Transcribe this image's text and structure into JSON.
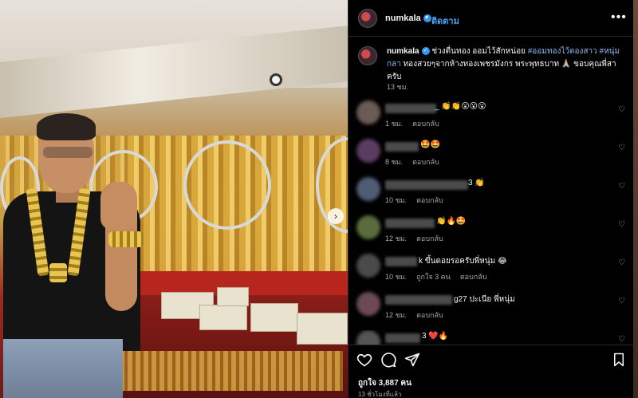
{
  "post": {
    "author": "numkala",
    "follow_label": "ติดตาม",
    "dot": "•",
    "more": "•••"
  },
  "caption": {
    "author": "numkala",
    "text_1": "ช่วงตื่นทอง ออมไว้สักหน่อย",
    "hashtag_1": "#ออมทองไว้ตองสาว",
    "hashtag_2": "#หนุ่มกลา",
    "text_2": "ทองสวยๆจากห้างทองเพชรมังกร พระพุทธบาท 🙏🏼 ขอบคุณพี่สาครับ",
    "time": "13 ชม."
  },
  "comments": [
    {
      "text": "_ 👏👏😮😮😮",
      "time": "1 ชม.",
      "reply": "ตอบกลับ",
      "likes": "",
      "avatar_color": "#6b5a55"
    },
    {
      "text": "🤩🤩",
      "time": "8 ชม.",
      "reply": "ตอบกลับ",
      "likes": "",
      "avatar_color": "#5a3c62"
    },
    {
      "text": "3 👏",
      "time": "10 ชม.",
      "reply": "ตอบกลับ",
      "likes": "",
      "avatar_color": "#4f5d74"
    },
    {
      "text": "👏🔥🤩",
      "time": "12 ชม.",
      "reply": "ตอบกลับ",
      "likes": "",
      "avatar_color": "#5a6b3c"
    },
    {
      "text": "k ขึ้นดอยรอครับพี่หนุ่ม 😂",
      "time": "10 ชม.",
      "reply": "ตอบกลับ",
      "likes": "ถูกใจ 3 คน",
      "avatar_color": "#4a4a4a"
    },
    {
      "text": "g27 ปะเนีย พี่หนุ่ม",
      "time": "12 ชม.",
      "reply": "ตอบกลับ",
      "likes": "",
      "avatar_color": "#6b4a55"
    },
    {
      "text": "3 ❤️🔥",
      "time": "",
      "reply": "",
      "likes": "",
      "avatar_color": "#555555"
    }
  ],
  "actions": {
    "likes": "ถูกใจ 3,887 คน",
    "time": "13 ชั่วโมงที่แล้ว"
  },
  "photo": {
    "next_icon": "›"
  },
  "icons": {
    "verified": "✓",
    "heart": "♡",
    "comment": "◯",
    "share": "➤",
    "save": "🔖"
  }
}
